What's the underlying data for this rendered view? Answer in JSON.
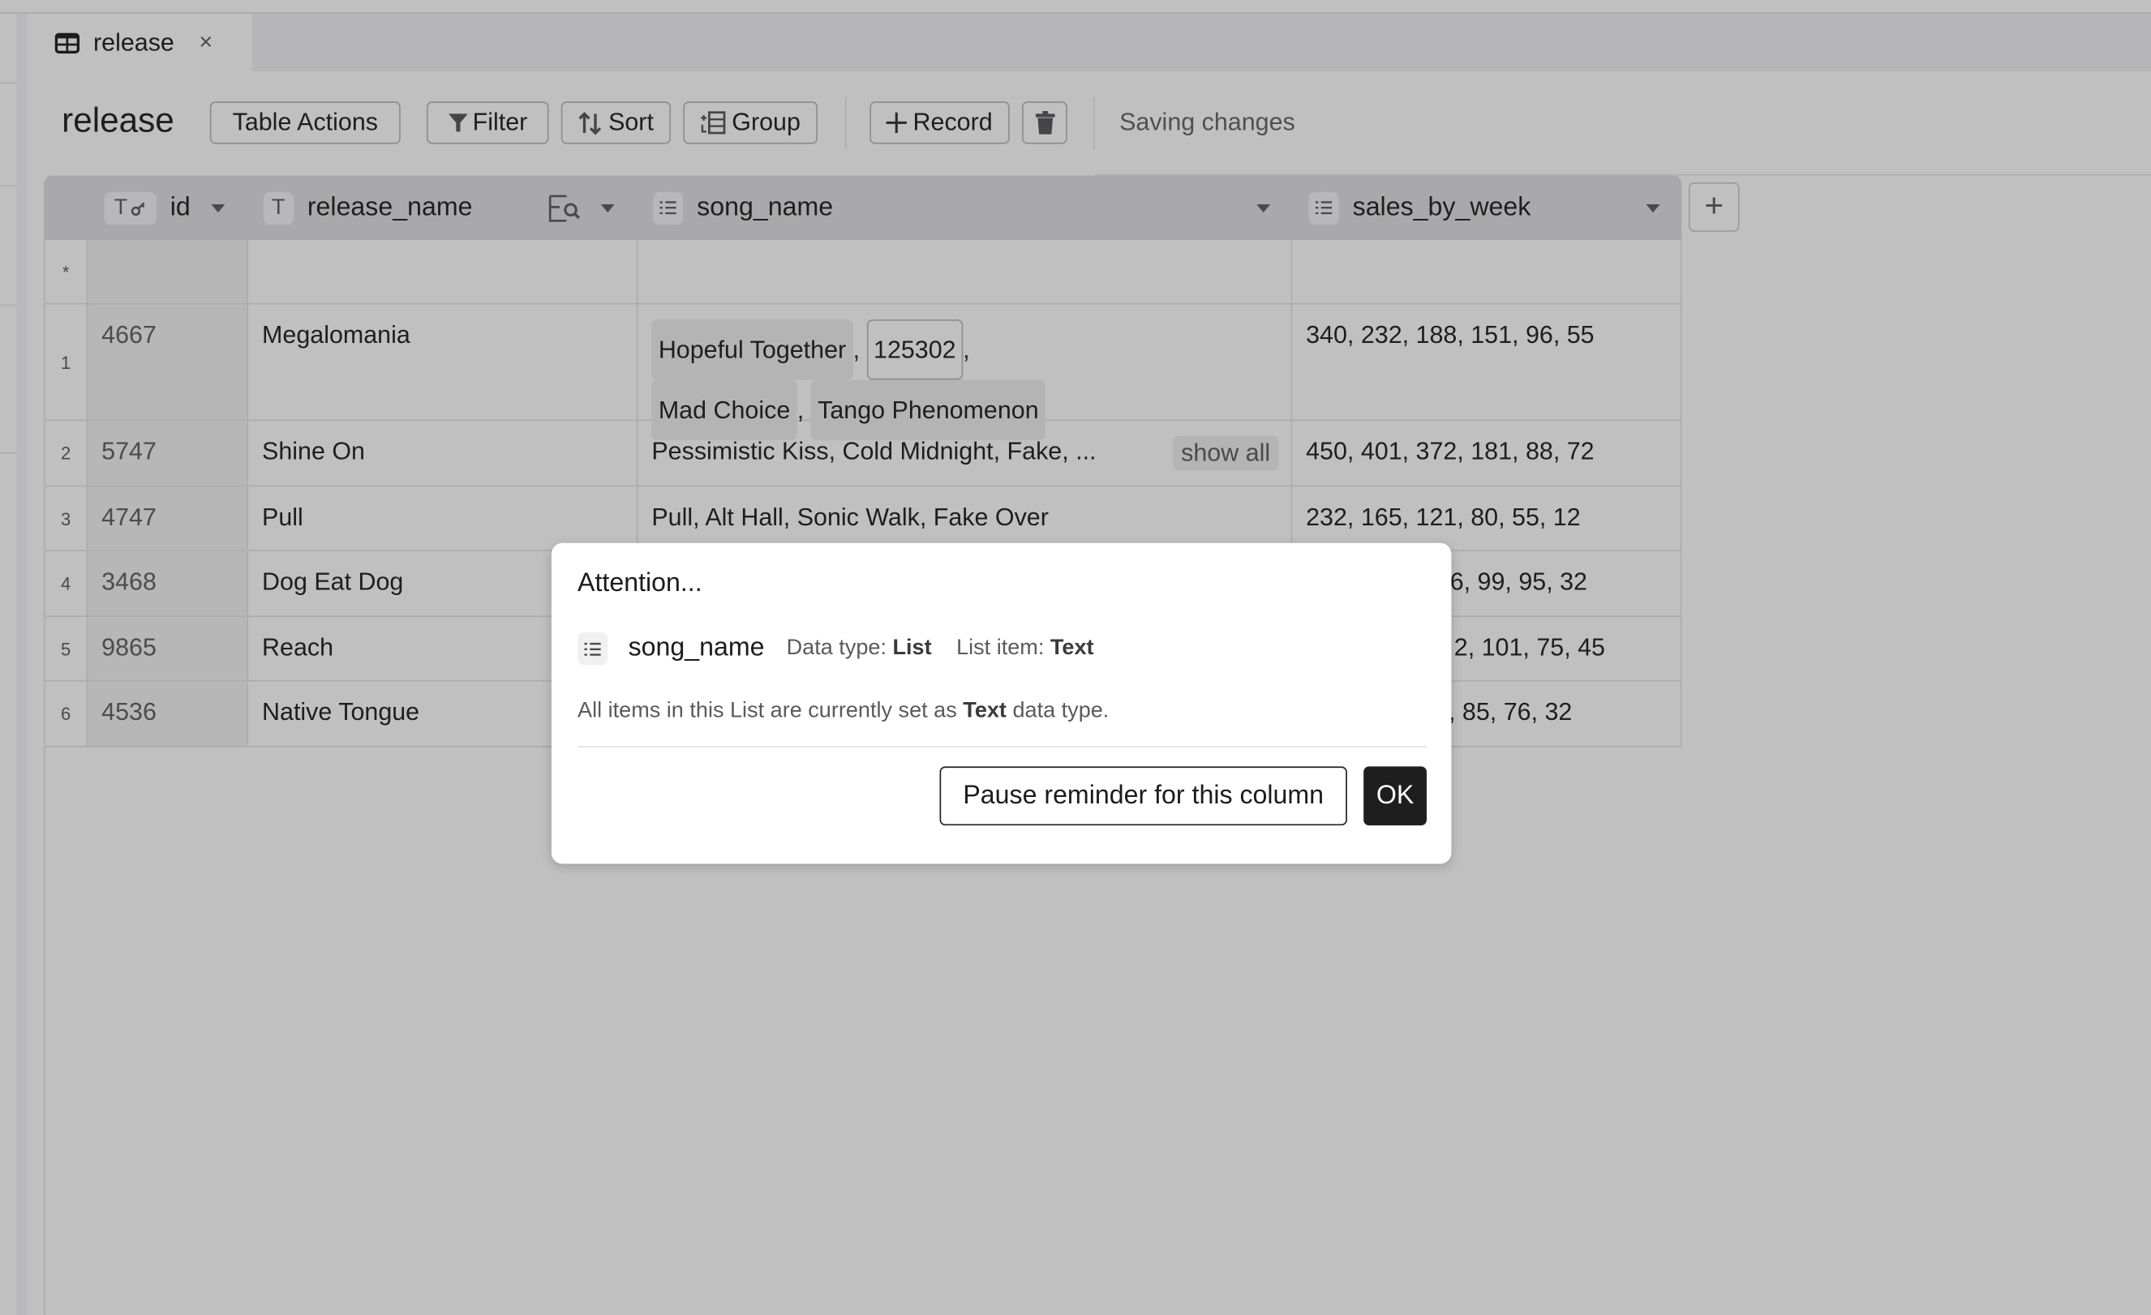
{
  "tab": {
    "label": "release",
    "icon": "table-icon",
    "close": "×"
  },
  "toolbar": {
    "title": "release",
    "table_actions": "Table Actions",
    "filter": "Filter",
    "sort": "Sort",
    "group": "Group",
    "record": "Record",
    "delete_icon": "trash-icon",
    "status": "Saving changes"
  },
  "columns": [
    {
      "name": "id",
      "type_badge": "T",
      "key": true
    },
    {
      "name": "release_name",
      "type_badge": "T"
    },
    {
      "name": "song_name",
      "type_badge": "list"
    },
    {
      "name": "sales_by_week",
      "type_badge": "list"
    }
  ],
  "new_row_marker": "*",
  "rows": [
    {
      "num": "1",
      "id": "4667",
      "release_name": "Megalomania",
      "song_name": {
        "chips": [
          "Hopeful Together",
          "125302",
          "Mad Choice",
          "Tango Phenomenon"
        ]
      },
      "sales_by_week": "340, 232, 188, 151, 96, 55"
    },
    {
      "num": "2",
      "id": "5747",
      "release_name": "Shine On",
      "song_name": {
        "text": "Pessimistic Kiss, Cold Midnight, Fake, ...",
        "show_all": "show all"
      },
      "sales_by_week": "450, 401, 372, 181, 88, 72"
    },
    {
      "num": "3",
      "id": "4747",
      "release_name": "Pull",
      "song_name": {
        "text": "Pull, Alt Hall, Sonic Walk, Fake Over"
      },
      "sales_by_week": "232, 165, 121, 80, 55, 12"
    },
    {
      "num": "4",
      "id": "3468",
      "release_name": "Dog Eat Dog",
      "song_name": {
        "text": ""
      },
      "sales_by_week": "6, 99, 95, 32"
    },
    {
      "num": "5",
      "id": "9865",
      "release_name": "Reach",
      "song_name": {
        "text": ""
      },
      "sales_by_week": "2, 101, 75, 45"
    },
    {
      "num": "6",
      "id": "4536",
      "release_name": "Native Tongue",
      "song_name": {
        "text": ""
      },
      "sales_by_week": ", 85, 76, 32"
    }
  ],
  "add_column": "+",
  "dialog": {
    "title": "Attention...",
    "column": "song_name",
    "data_type_label": "Data type:",
    "data_type": "List",
    "list_item_label": "List item:",
    "list_item": "Text",
    "message_prefix": "All items in this List are currently set as",
    "message_bold": "Text",
    "message_suffix": "data type.",
    "pause_button": "Pause reminder for this column",
    "ok_button": "OK"
  }
}
